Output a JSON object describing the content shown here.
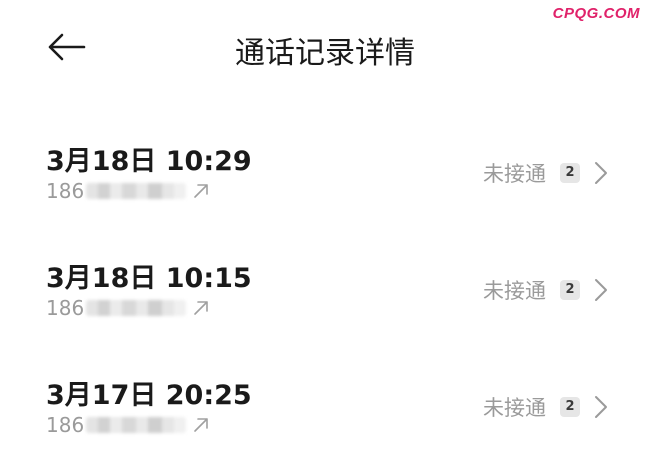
{
  "watermark": "CPQG.COM",
  "header": {
    "title": "通话记录详情",
    "back_icon": "arrow-left-icon"
  },
  "records": [
    {
      "time": "3月18日 10:29",
      "number_prefix": "186",
      "status": "未接通",
      "count": "2"
    },
    {
      "time": "3月18日 10:15",
      "number_prefix": "186",
      "status": "未接通",
      "count": "2"
    },
    {
      "time": "3月17日 20:25",
      "number_prefix": "186",
      "status": "未接通",
      "count": "2"
    }
  ],
  "colors": {
    "text_primary": "#1a1a1a",
    "text_secondary": "#9a9a9a",
    "watermark": "#e0226a",
    "badge_bg": "#e6e6e6"
  }
}
